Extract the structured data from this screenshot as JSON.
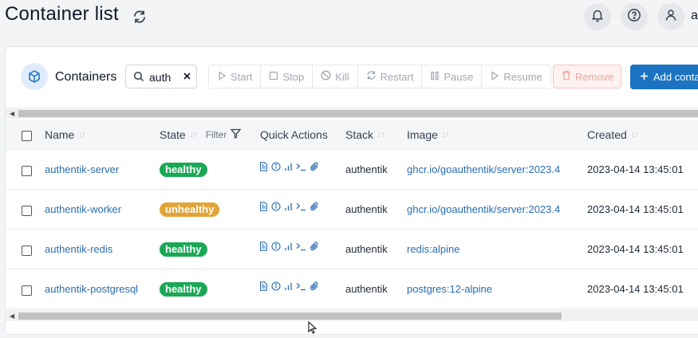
{
  "page": {
    "title": "Container list",
    "user_initial": "a"
  },
  "card": {
    "title": "Containers",
    "search": {
      "value": "auth"
    },
    "actions": {
      "start": "Start",
      "stop": "Stop",
      "kill": "Kill",
      "restart": "Restart",
      "pause": "Pause",
      "resume": "Resume",
      "remove": "Remove",
      "add": "Add conta"
    },
    "columns": {
      "name": "Name",
      "state": "State",
      "filter": "Filter",
      "quick_actions": "Quick Actions",
      "stack": "Stack",
      "image": "Image",
      "created": "Created"
    },
    "rows": [
      {
        "name": "authentik-server",
        "state": "healthy",
        "stack": "authentik",
        "image": "ghcr.io/goauthentik/server:2023.4",
        "created": "2023-04-14 13:45:01"
      },
      {
        "name": "authentik-worker",
        "state": "unhealthy",
        "stack": "authentik",
        "image": "ghcr.io/goauthentik/server:2023.4",
        "created": "2023-04-14 13:45:01"
      },
      {
        "name": "authentik-redis",
        "state": "healthy",
        "stack": "authentik",
        "image": "redis:alpine",
        "created": "2023-04-14 13:45:01"
      },
      {
        "name": "authentik-postgresql",
        "state": "healthy",
        "stack": "authentik",
        "image": "postgres:12-alpine",
        "created": "2023-04-14 13:45:01"
      }
    ]
  },
  "colors": {
    "healthy": "#1aa856",
    "unhealthy": "#e3a437",
    "primary": "#1b73c2",
    "link": "#2a6db0"
  },
  "icons": [
    "refresh-icon",
    "bell-icon",
    "help-icon",
    "user-icon",
    "box-icon",
    "search-icon",
    "clear-icon",
    "logs-icon",
    "inspect-icon",
    "stats-icon",
    "console-icon",
    "attach-icon"
  ]
}
